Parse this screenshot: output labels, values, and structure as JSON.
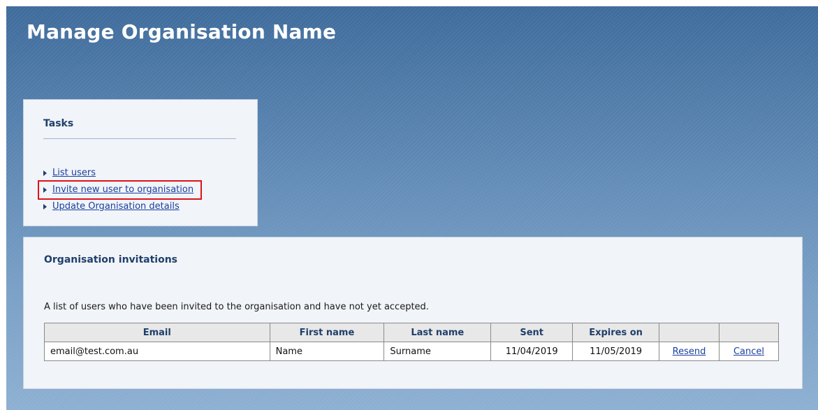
{
  "header": {
    "title": "Manage Organisation Name"
  },
  "tasks": {
    "heading": "Tasks",
    "items": [
      {
        "label": "List users"
      },
      {
        "label": "Invite new user to organisation"
      },
      {
        "label": "Update Organisation details"
      }
    ]
  },
  "invitations": {
    "heading": "Organisation invitations",
    "description": "A list of users who have been invited to the organisation and have not yet accepted.",
    "columns": [
      "Email",
      "First name",
      "Last name",
      "Sent",
      "Expires on",
      "",
      ""
    ],
    "rows": [
      {
        "email": "email@test.com.au",
        "first_name": "Name",
        "last_name": "Surname",
        "sent": "11/04/2019",
        "expires_on": "11/05/2019",
        "resend_label": "Resend",
        "cancel_label": "Cancel"
      }
    ]
  },
  "colors": {
    "highlight_box": "#e0121a",
    "link": "#1a3fa0",
    "heading": "#1f3f6b"
  }
}
